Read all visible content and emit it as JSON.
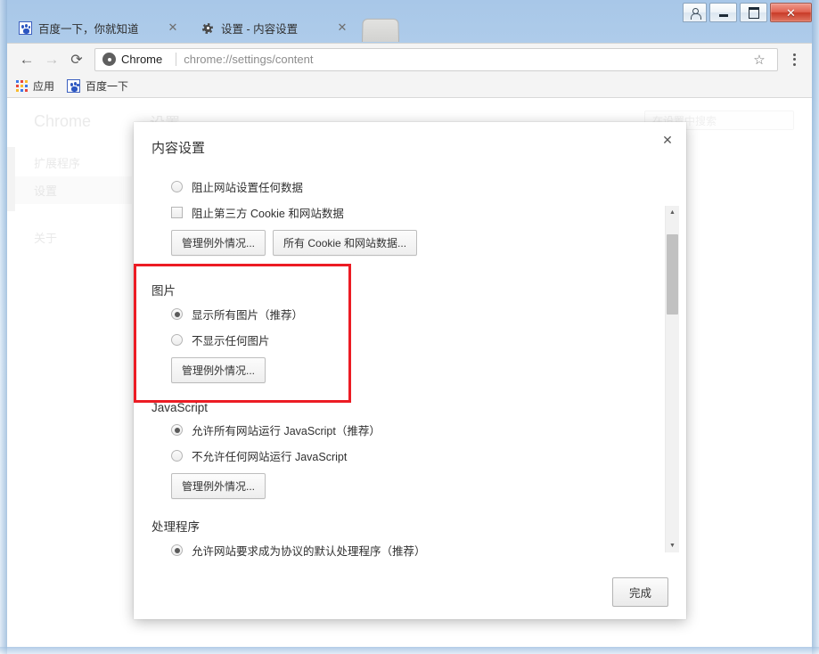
{
  "window": {
    "caption_buttons": [
      {
        "name": "user-account",
        "glyph": "user"
      },
      {
        "name": "minimize",
        "glyph": "minimize"
      },
      {
        "name": "maximize",
        "glyph": "maximize"
      },
      {
        "name": "close",
        "glyph": "✕"
      }
    ]
  },
  "tabs": [
    {
      "title": "百度一下，你就知道",
      "favicon": "baidu-paw-icon",
      "active": false,
      "close_glyph": "✕"
    },
    {
      "title": "设置 - 内容设置",
      "favicon": "gear-icon",
      "active": true,
      "close_glyph": "✕"
    }
  ],
  "toolbar": {
    "back_glyph": "←",
    "forward_glyph": "→",
    "reload_glyph": "⟳",
    "security_label": "Chrome",
    "url": "chrome://settings/content",
    "star_glyph": "☆"
  },
  "bookmarks": [
    {
      "label": "应用",
      "icon": "apps-grid-icon"
    },
    {
      "label": "百度一下",
      "icon": "baidu-paw-icon"
    }
  ],
  "settings_page": {
    "brand": "Chrome",
    "nav": [
      {
        "label": "扩展程序",
        "active": false
      },
      {
        "label": "设置",
        "active": true
      },
      {
        "label": "关于",
        "active": false
      }
    ],
    "header_title": "设置",
    "search_placeholder": "在设置中搜索",
    "ghost_text": "允许网站要求成为协议的默认处理程序"
  },
  "dialog": {
    "title": "内容设置",
    "close_glyph": "✕",
    "done_label": "完成",
    "sections": [
      {
        "name": "cookies",
        "title": "",
        "options": [
          {
            "type": "radio",
            "label": "阻止网站设置任何数据",
            "checked": false
          },
          {
            "type": "checkbox",
            "label": "阻止第三方 Cookie 和网站数据",
            "checked": false
          }
        ],
        "buttons": [
          "管理例外情况...",
          "所有 Cookie 和网站数据..."
        ]
      },
      {
        "name": "images",
        "title": "图片",
        "options": [
          {
            "type": "radio",
            "label": "显示所有图片（推荐）",
            "checked": true
          },
          {
            "type": "radio",
            "label": "不显示任何图片",
            "checked": false
          }
        ],
        "buttons": [
          "管理例外情况..."
        ]
      },
      {
        "name": "javascript",
        "title": "JavaScript",
        "options": [
          {
            "type": "radio",
            "label": "允许所有网站运行 JavaScript（推荐）",
            "checked": true
          },
          {
            "type": "radio",
            "label": "不允许任何网站运行 JavaScript",
            "checked": false
          }
        ],
        "buttons": [
          "管理例外情况..."
        ]
      },
      {
        "name": "handlers",
        "title": "处理程序",
        "options": [
          {
            "type": "radio",
            "label": "允许网站要求成为协议的默认处理程序（推荐）",
            "checked": true
          }
        ],
        "buttons": []
      }
    ]
  },
  "annotation": {
    "color": "#ec1c24",
    "target_section": "图片"
  }
}
